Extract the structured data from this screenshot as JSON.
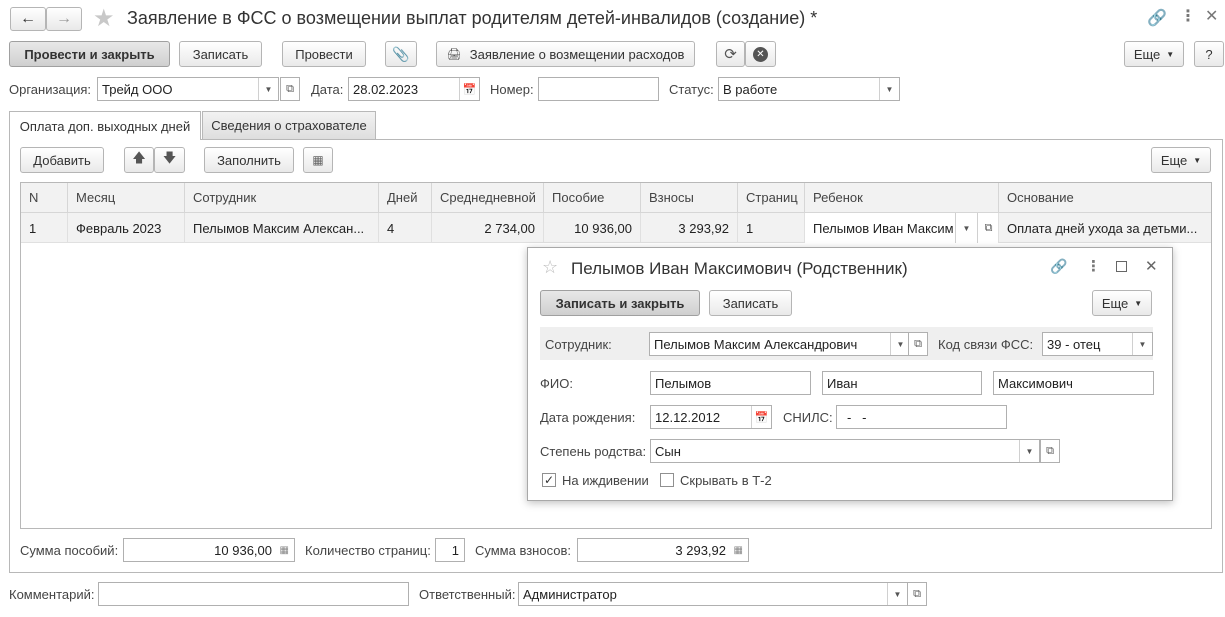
{
  "window": {
    "title": "Заявление в ФСС о возмещении выплат родителям детей-инвалидов (создание) *"
  },
  "toolbar": {
    "post_close": "Провести и закрыть",
    "save": "Записать",
    "post": "Провести",
    "print_label": "Заявление о возмещении расходов",
    "more": "Еще",
    "help": "?"
  },
  "header_fields": {
    "org_label": "Организация:",
    "org_value": "Трейд ООО",
    "date_label": "Дата:",
    "date_value": "28.02.2023",
    "number_label": "Номер:",
    "number_value": "",
    "status_label": "Статус:",
    "status_value": "В работе"
  },
  "tabs": [
    {
      "label": "Оплата доп. выходных дней",
      "active": true
    },
    {
      "label": "Сведения о страхователе",
      "active": false
    }
  ],
  "table_toolbar": {
    "add": "Добавить",
    "fill": "Заполнить",
    "more": "Еще"
  },
  "table": {
    "columns": [
      "N",
      "Месяц",
      "Сотрудник",
      "Дней",
      "Среднедневной",
      "Пособие",
      "Взносы",
      "Страниц",
      "Ребенок",
      "Основание"
    ],
    "rows": [
      [
        "1",
        "Февраль 2023",
        "Пелымов Максим Алексан...",
        "4",
        "2 734,00",
        "10 936,00",
        "3 293,92",
        "1",
        "Пелымов Иван Максим",
        "Оплата дней ухода за детьми..."
      ]
    ]
  },
  "totals": {
    "benefits_label": "Сумма пособий:",
    "benefits_value": "10 936,00",
    "pages_label": "Количество страниц:",
    "pages_value": "1",
    "contrib_label": "Сумма взносов:",
    "contrib_value": "3 293,92"
  },
  "footer": {
    "comment_label": "Комментарий:",
    "comment_value": "",
    "responsible_label": "Ответственный:",
    "responsible_value": "Администратор"
  },
  "dialog": {
    "title": "Пелымов Иван Максимович (Родственник)",
    "save_close": "Записать и закрыть",
    "save": "Записать",
    "more": "Еще",
    "employee_label": "Сотрудник:",
    "employee_value": "Пелымов Максим Александрович",
    "fss_code_label": "Код связи ФСС:",
    "fss_code_value": "39 - отец",
    "fio_label": "ФИО:",
    "last_name": "Пелымов",
    "first_name": "Иван",
    "middle_name": "Максимович",
    "birth_label": "Дата рождения:",
    "birth_value": "12.12.2012",
    "snils_label": "СНИЛС:",
    "snils_value": "-   -",
    "relation_label": "Степень родства:",
    "relation_value": "Сын",
    "dependent_label": "На иждивении",
    "dependent_checked": true,
    "hide_t2_label": "Скрывать в Т-2",
    "hide_t2_checked": false
  },
  "colors": {
    "accent_star": "#c8c8c8",
    "border": "#b5b5b5",
    "selected_row": "#f2f2f2"
  }
}
